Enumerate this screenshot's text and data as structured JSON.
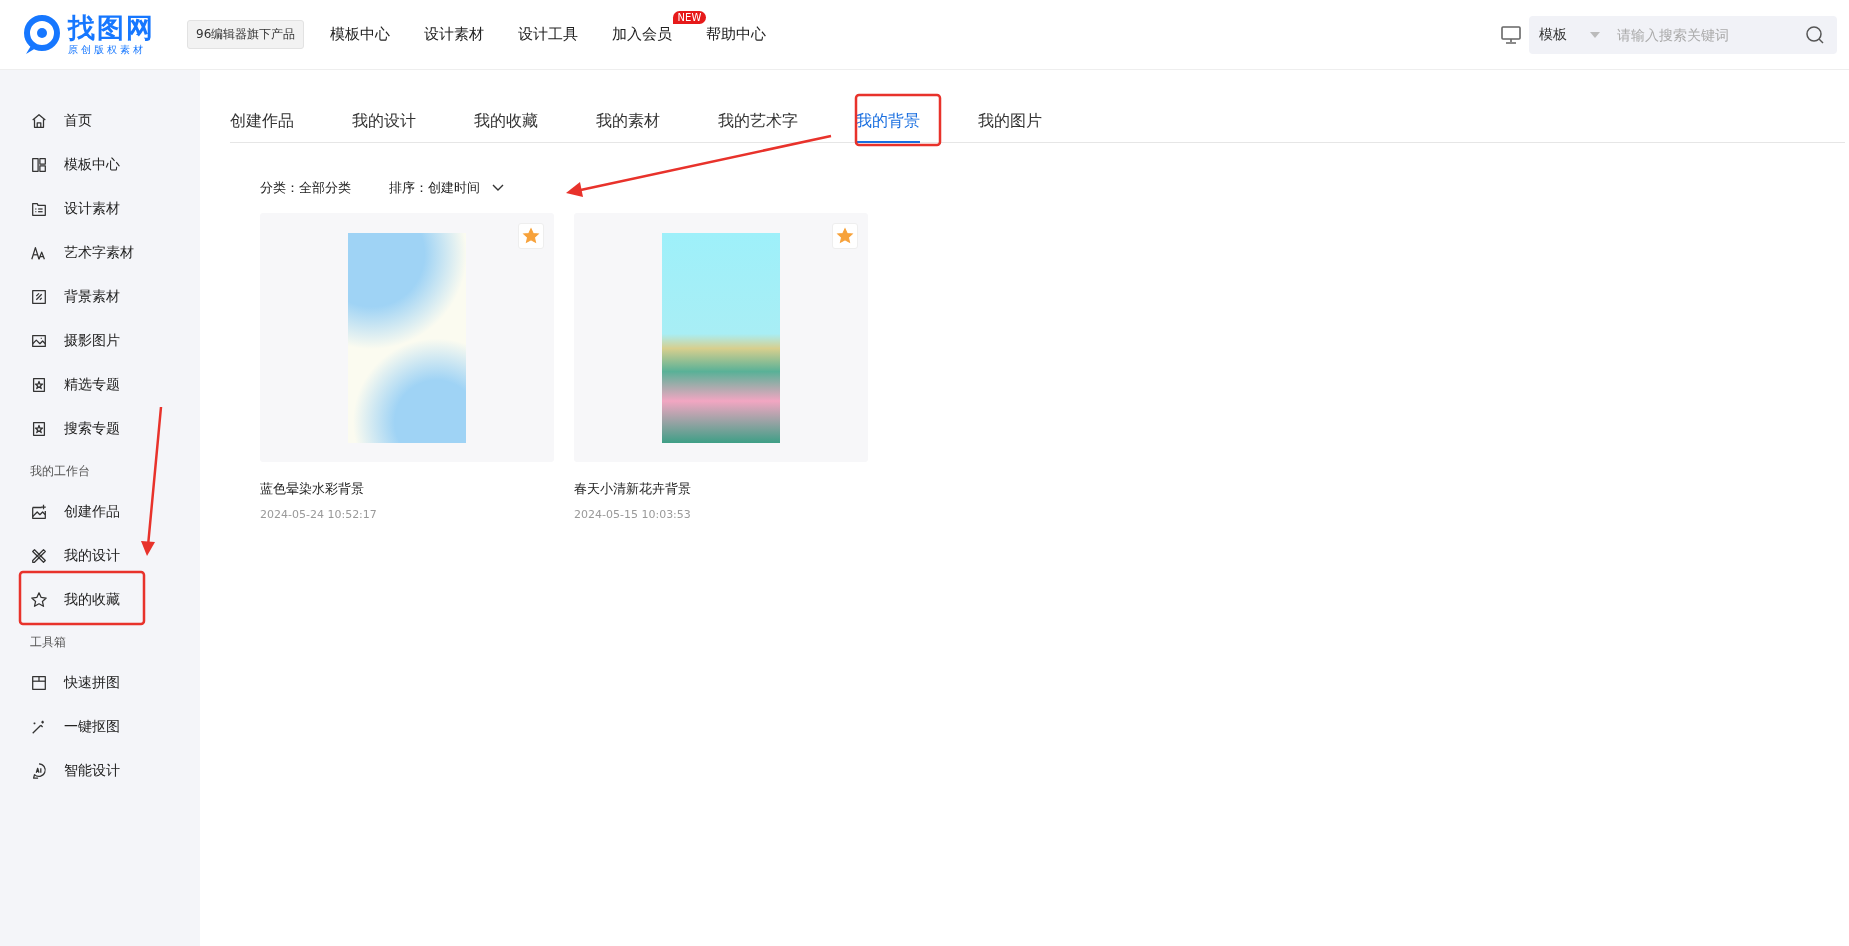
{
  "header": {
    "logo": {
      "name": "找图网",
      "tagline": "原创版权素材"
    },
    "badge": "96编辑器旗下产品",
    "nav": [
      {
        "label": "模板中心"
      },
      {
        "label": "设计素材"
      },
      {
        "label": "设计工具"
      },
      {
        "label": "加入会员",
        "tag": "NEW"
      },
      {
        "label": "帮助中心"
      }
    ],
    "search": {
      "scope": "模板",
      "placeholder": "请输入搜索关键词"
    }
  },
  "sidebar": {
    "groups": [
      {
        "items": [
          {
            "label": "首页"
          },
          {
            "label": "模板中心"
          },
          {
            "label": "设计素材"
          },
          {
            "label": "艺术字素材"
          },
          {
            "label": "背景素材"
          },
          {
            "label": "摄影图片"
          },
          {
            "label": "精选专题"
          },
          {
            "label": "搜索专题"
          }
        ]
      },
      {
        "title": "我的工作台",
        "items": [
          {
            "label": "创建作品"
          },
          {
            "label": "我的设计"
          },
          {
            "label": "我的收藏"
          }
        ]
      },
      {
        "title": "工具箱",
        "items": [
          {
            "label": "快速拼图"
          },
          {
            "label": "一键抠图"
          },
          {
            "label": "智能设计"
          }
        ]
      }
    ]
  },
  "tabs": [
    {
      "label": "创建作品",
      "selected": false
    },
    {
      "label": "我的设计",
      "selected": false
    },
    {
      "label": "我的收藏",
      "selected": false
    },
    {
      "label": "我的素材",
      "selected": false
    },
    {
      "label": "我的艺术字",
      "selected": false
    },
    {
      "label": "我的背景",
      "selected": true
    },
    {
      "label": "我的图片",
      "selected": false
    }
  ],
  "filters": [
    {
      "text": "分类：全部分类",
      "dropdown": false
    },
    {
      "text": "排序：创建时间",
      "dropdown": true
    }
  ],
  "cards": [
    {
      "title": "蓝色晕染水彩背景",
      "date": "2024-05-24 10:52:17",
      "favorited": true,
      "kind": "watercolor"
    },
    {
      "title": "春天小清新花卉背景",
      "date": "2024-05-15 10:03:53",
      "favorited": true,
      "kind": "flowers"
    }
  ]
}
